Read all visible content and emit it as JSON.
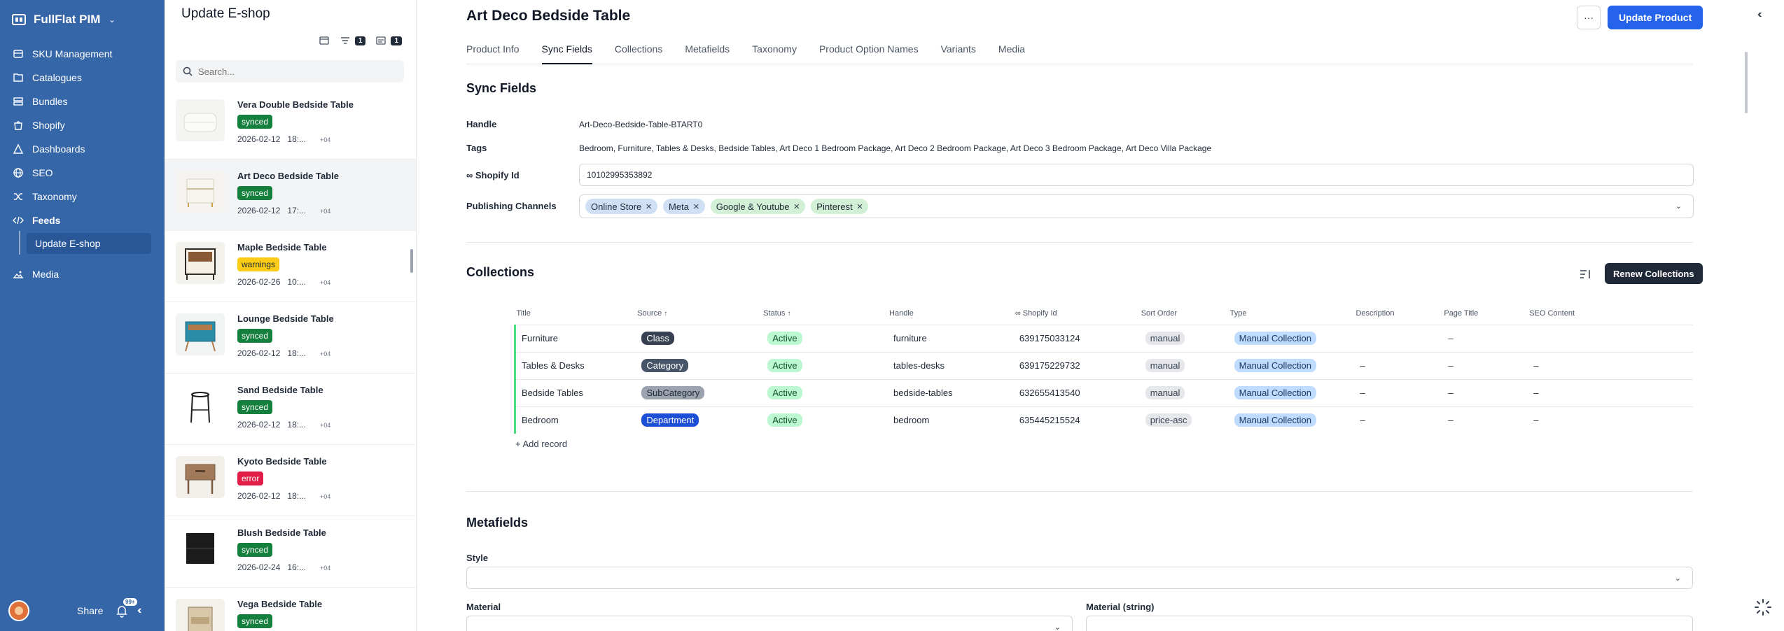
{
  "sidebar": {
    "brand": "FullFlat PIM",
    "items": [
      {
        "label": "SKU Management",
        "icon": "box-icon"
      },
      {
        "label": "Catalogues",
        "icon": "book-icon"
      },
      {
        "label": "Bundles",
        "icon": "stack-icon"
      },
      {
        "label": "Shopify",
        "icon": "bag-icon"
      },
      {
        "label": "Dashboards",
        "icon": "dashboard-icon"
      },
      {
        "label": "SEO",
        "icon": "globe-icon"
      },
      {
        "label": "Taxonomy",
        "icon": "shuffle-icon"
      },
      {
        "label": "Feeds",
        "icon": "code-icon"
      },
      {
        "label": "Media",
        "icon": "image-icon"
      }
    ],
    "sub_item": "Update E-shop",
    "share": "Share",
    "notif_badge": "99+"
  },
  "list": {
    "title": "Update E-shop",
    "filter_count": "1",
    "group_count": "1",
    "search_placeholder": "Search...",
    "products": [
      {
        "name": "Vera Double Bedside Table",
        "status": "synced",
        "date": "2026-02-12",
        "time": "18:...",
        "tz": "+04"
      },
      {
        "name": "Art Deco Bedside Table",
        "status": "synced",
        "date": "2026-02-12",
        "time": "17:...",
        "tz": "+04"
      },
      {
        "name": "Maple Bedside Table",
        "status": "warnings",
        "date": "2026-02-26",
        "time": "10:...",
        "tz": "+04"
      },
      {
        "name": "Lounge Bedside Table",
        "status": "synced",
        "date": "2026-02-12",
        "time": "18:...",
        "tz": "+04"
      },
      {
        "name": "Sand Bedside Table",
        "status": "synced",
        "date": "2026-02-12",
        "time": "18:...",
        "tz": "+04"
      },
      {
        "name": "Kyoto Bedside Table",
        "status": "error",
        "date": "2026-02-12",
        "time": "18:...",
        "tz": "+04"
      },
      {
        "name": "Blush Bedside Table",
        "status": "synced",
        "date": "2026-02-24",
        "time": "16:...",
        "tz": "+04"
      },
      {
        "name": "Vega Bedside Table",
        "status": "synced",
        "date": "",
        "time": "",
        "tz": ""
      }
    ]
  },
  "main": {
    "title": "Art Deco Bedside Table",
    "more_label": "···",
    "update_label": "Update Product",
    "tabs": [
      "Product Info",
      "Sync Fields",
      "Collections",
      "Metafields",
      "Taxonomy",
      "Product Option Names",
      "Variants",
      "Media"
    ],
    "sync": {
      "title": "Sync Fields",
      "handle_label": "Handle",
      "handle_value": "Art-Deco-Bedside-Table-BTART0",
      "tags_label": "Tags",
      "tags_value": "Bedroom, Furniture, Tables & Desks, Bedside Tables, Art Deco 1 Bedroom Package, Art Deco 2 Bedroom Package, Art Deco 3 Bedroom Package, Art Deco Villa Package",
      "shopify_label": "∞ Shopify Id",
      "shopify_value": "10102995353892",
      "channels_label": "Publishing Channels",
      "channels": [
        {
          "name": "Online Store",
          "color": "blue"
        },
        {
          "name": "Meta",
          "color": "blue"
        },
        {
          "name": "Google & Youtube",
          "color": "green"
        },
        {
          "name": "Pinterest",
          "color": "green"
        }
      ]
    },
    "collections": {
      "title": "Collections",
      "renew_label": "Renew Collections",
      "headers": [
        "Title",
        "Source",
        "Status",
        "Handle",
        "∞ Shopify Id",
        "Sort Order",
        "Type",
        "Description",
        "Page Title",
        "SEO Content"
      ],
      "rows": [
        {
          "title": "Furniture",
          "source": "Class",
          "status": "Active",
          "handle": "furniture",
          "shopify_id": "639175033124",
          "sort": "manual",
          "type": "Manual Collection",
          "desc": "",
          "page_title": "–",
          "seo": ""
        },
        {
          "title": "Tables & Desks",
          "source": "Category",
          "status": "Active",
          "handle": "tables-desks",
          "shopify_id": "639175229732",
          "sort": "manual",
          "type": "Manual Collection",
          "desc": "–",
          "page_title": "–",
          "seo": "–"
        },
        {
          "title": "Bedside Tables",
          "source": "SubCategory",
          "status": "Active",
          "handle": "bedside-tables",
          "shopify_id": "632655413540",
          "sort": "manual",
          "type": "Manual Collection",
          "desc": "–",
          "page_title": "–",
          "seo": "–"
        },
        {
          "title": "Bedroom",
          "source": "Department",
          "status": "Active",
          "handle": "bedroom",
          "shopify_id": "635445215524",
          "sort": "price-asc",
          "type": "Manual Collection",
          "desc": "–",
          "page_title": "–",
          "seo": "–"
        }
      ],
      "add_record": "+ Add record"
    },
    "metafields": {
      "title": "Metafields",
      "style_label": "Style",
      "material_label": "Material",
      "material_string_label": "Material (string)"
    }
  }
}
